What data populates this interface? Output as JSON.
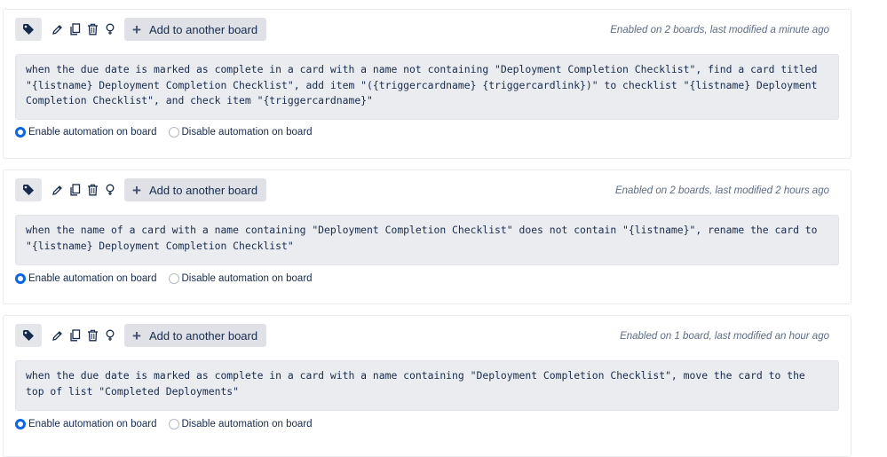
{
  "common": {
    "add_button_label": "Add to another board",
    "enable_label": "Enable automation on board",
    "disable_label": "Disable automation on board"
  },
  "icons": [
    "tag-icon",
    "pencil-icon",
    "copy-icon",
    "trash-icon",
    "lightbulb-icon",
    "plus-icon"
  ],
  "colors": {
    "accent": "#0c66e4",
    "rule_bg": "#ebecf0",
    "button_bg": "#dfe1e6"
  },
  "rules": [
    {
      "status": "Enabled on 2 boards, last modified a minute ago",
      "text": "when the due date is marked as complete in a card with a name not containing \"Deployment Completion Checklist\", find a card titled \"{listname} Deployment Completion Checklist\", add item \"({triggercardname} {triggercardlink})\" to checklist \"{listname} Deployment Completion Checklist\", and check item \"{triggercardname}\"",
      "enabled": true
    },
    {
      "status": "Enabled on 2 boards, last modified 2 hours ago",
      "text": "when the name of a card with a name containing \"Deployment Completion Checklist\" does not contain \"{listname}\", rename the card to \"{listname} Deployment Completion Checklist\"",
      "enabled": true
    },
    {
      "status": "Enabled on 1 board, last modified an hour ago",
      "text": "when the due date is marked as complete in a card with a name containing \"Deployment Completion Checklist\", move the card to the top of list \"Completed Deployments\"",
      "enabled": true
    }
  ]
}
